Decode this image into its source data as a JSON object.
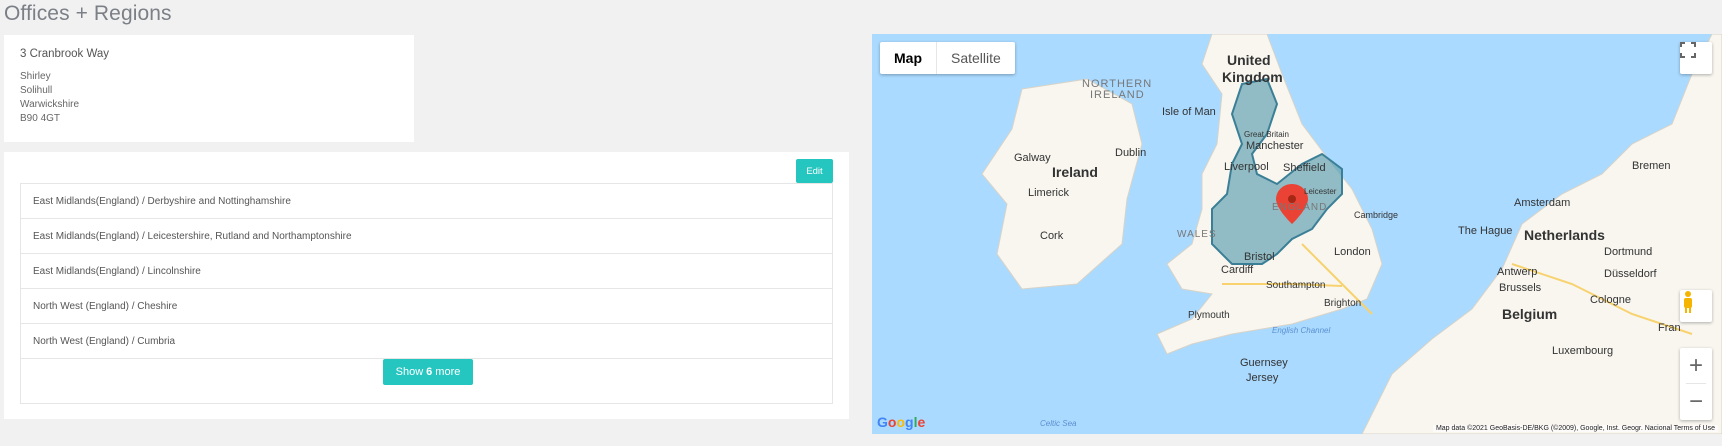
{
  "page_title": "Offices + Regions",
  "address": {
    "title": "3 Cranbrook Way",
    "lines": [
      "Shirley",
      "Solihull",
      "Warwickshire",
      "B90 4GT"
    ]
  },
  "regions": {
    "edit_label": "Edit",
    "items": [
      "East Midlands(England) / Derbyshire and Nottinghamshire",
      "East Midlands(England) / Leicestershire, Rutland and Northamptonshire",
      "East Midlands(England) / Lincolnshire",
      "North West (England) / Cheshire",
      "North West (England) / Cumbria"
    ],
    "show_more_prefix": "Show",
    "show_more_count": "6",
    "show_more_suffix": "more"
  },
  "map": {
    "type_buttons": [
      "Map",
      "Satellite"
    ],
    "labels": {
      "uk": "United",
      "uk2": "Kingdom",
      "northern_ireland": "NORTHERN",
      "northern_ireland2": "IRELAND",
      "isle_of_man": "Isle of Man",
      "ireland": "Ireland",
      "dublin": "Dublin",
      "galway": "Galway",
      "limerick": "Limerick",
      "cork": "Cork",
      "great_britain": "Great Britain",
      "manchester": "Manchester",
      "liverpool": "Liverpool",
      "sheffield": "Sheffield",
      "wales": "WALES",
      "bristol": "Bristol",
      "cardiff": "Cardiff",
      "london": "London",
      "cambridge": "Cambridge",
      "southampton": "Southampton",
      "brighton": "Brighton",
      "plymouth": "Plymouth",
      "english_channel": "English Channel",
      "celtic_sea": "Celtic Sea",
      "guernsey": "Guernsey",
      "jersey": "Jersey",
      "the_hague": "The Hague",
      "amsterdam": "Amsterdam",
      "netherlands": "Netherlands",
      "dortmund": "Dortmund",
      "antwerp": "Antwerp",
      "brussels": "Brussels",
      "dusseldorf": "Düsseldorf",
      "cologne": "Cologne",
      "belgium": "Belgium",
      "luxembourg": "Luxembourg",
      "bremen": "Bremen",
      "fran": "Fran",
      "ireland_town": "Leicester",
      "enyland": "ENGLAND"
    },
    "google": "Google",
    "attribution": "Map data ©2021 GeoBasis-DE/BKG (©2009), Google, Inst. Geogr. Nacional    Terms of Use",
    "colors": {
      "water": "#aadaff",
      "land": "#f8f6ef",
      "region_fill": "#5a9dae",
      "region_stroke": "#3b7f97",
      "marker": "#ea4335"
    }
  }
}
